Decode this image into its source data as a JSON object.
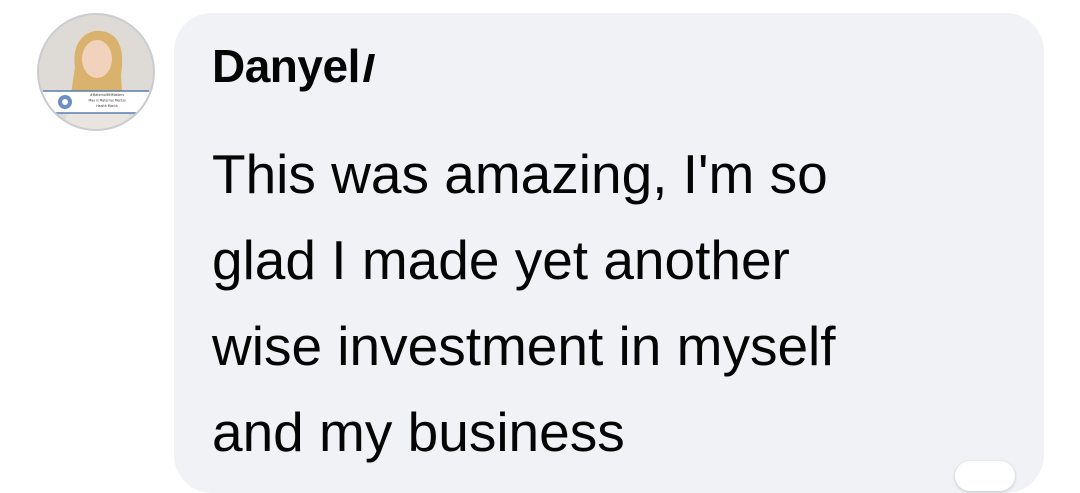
{
  "comment": {
    "author_name": "Danyel",
    "message": "This was amazing, I'm so\nglad I made yet another\nwise investment in myself\nand my business",
    "avatar": {
      "icon": "profile-photo",
      "badge_lines": [
        "#MaternalMHMatters",
        "May is Maternal Mental",
        "Health Month"
      ]
    }
  },
  "colors": {
    "bubble_background": "#f0f2f5",
    "text": "#050505",
    "avatar_border": "#c9ccd1"
  }
}
